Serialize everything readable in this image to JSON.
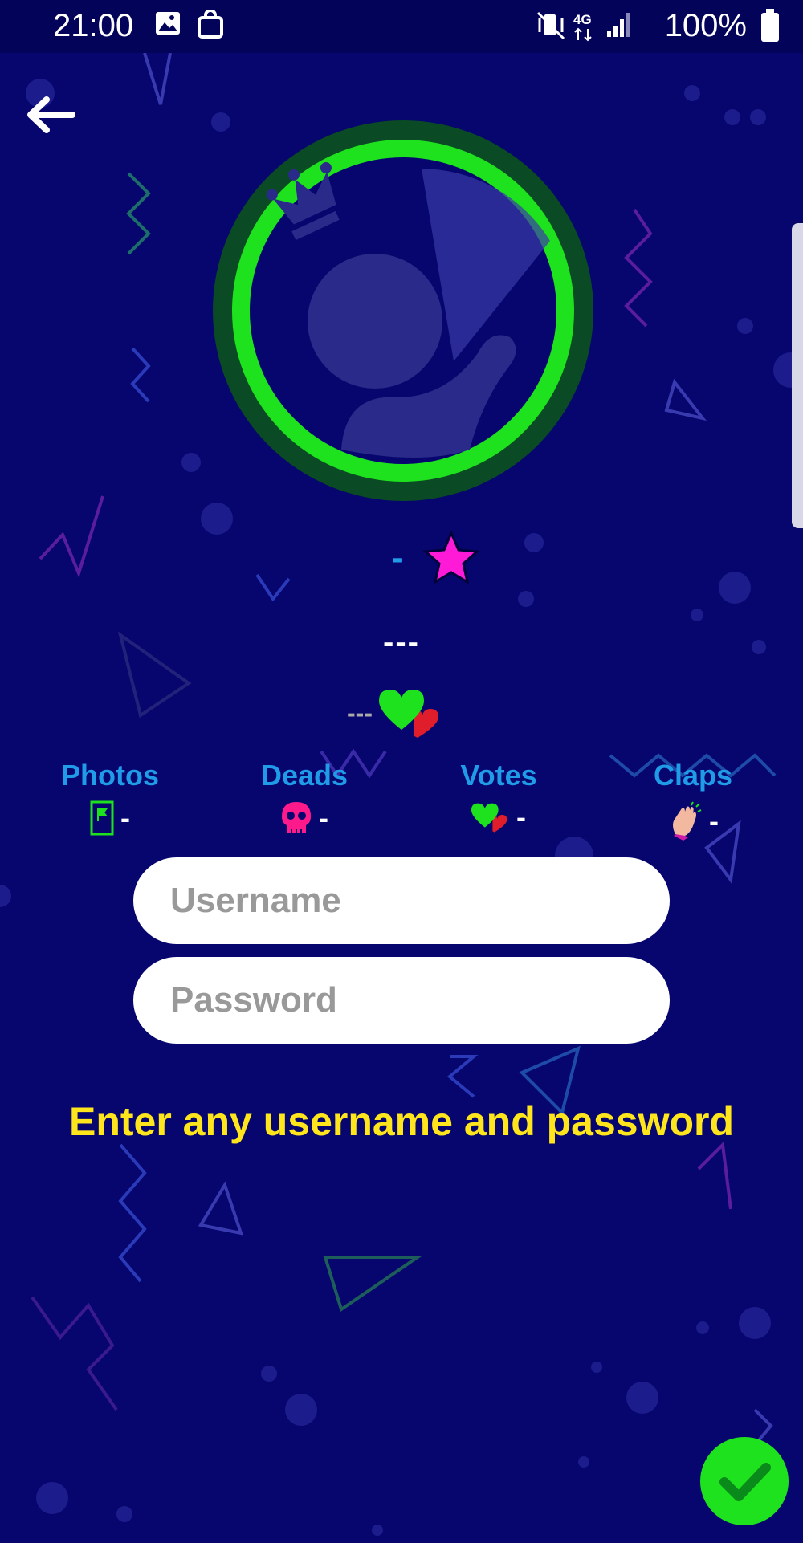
{
  "status_bar": {
    "time": "21:00",
    "battery": "100%",
    "icons": [
      "image-icon",
      "bag-icon",
      "mute-vibrate-icon",
      "network-4g-icon",
      "signal-icon",
      "battery-icon"
    ]
  },
  "profile": {
    "rank_value": "-",
    "rank_icon": "star-icon",
    "name": "---",
    "votes_value": "---",
    "votes_icon": "hearts-icon"
  },
  "stats": [
    {
      "label": "Photos",
      "value": "-",
      "icon": "photo-flag-icon"
    },
    {
      "label": "Deads",
      "value": "-",
      "icon": "skull-icon"
    },
    {
      "label": "Votes",
      "value": "-",
      "icon": "hearts-icon"
    },
    {
      "label": "Claps",
      "value": "-",
      "icon": "clap-icon"
    }
  ],
  "form": {
    "username_placeholder": "Username",
    "username_value": "",
    "password_placeholder": "Password",
    "password_value": ""
  },
  "hint": "Enter any username and password",
  "colors": {
    "background": "#06066e",
    "accent_blue": "#1f9be8",
    "ring_green": "#1ee21e",
    "hint_yellow": "#ffe51c",
    "star_pink": "#ff1ad8"
  }
}
